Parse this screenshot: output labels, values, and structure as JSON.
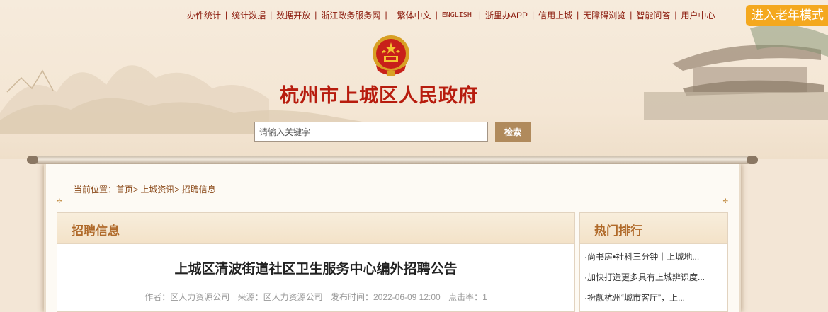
{
  "topnav": {
    "items": [
      "办件统计",
      "统计数据",
      "数据开放",
      "浙江政务服务网",
      "繁体中文",
      "ENGLISH",
      "浙里办APP",
      "信用上城",
      "无障碍浏览",
      "智能问答",
      "用户中心"
    ]
  },
  "elder_mode_label": "进入老年模式",
  "site_title": "杭州市上城区人民政府",
  "search": {
    "placeholder": "请输入关键字",
    "button": "检索"
  },
  "breadcrumb": {
    "prefix": "当前位置：",
    "items": [
      "首页",
      "上城资讯",
      "招聘信息"
    ],
    "separator": ">"
  },
  "main": {
    "section_title": "招聘信息",
    "article_title": "上城区清波街道社区卫生服务中心编外招聘公告",
    "meta": {
      "author": "作者：区人力资源公司",
      "source": "来源：区人力资源公司",
      "published": "发布时间：2022-06-09 12:00",
      "clicks": "点击率：1"
    }
  },
  "sidebar": {
    "title": "热门排行",
    "items": [
      "·尚书房•社科三分钟｜上城地...",
      "·加快打造更多具有上城辨识度...",
      "·扮靓杭州“城市客厅”，上..."
    ]
  },
  "colors": {
    "accent_red": "#b71c0e",
    "elder_orange": "#f4a81e",
    "panel_title": "#b06a2a",
    "button_brown": "#b08a5c"
  }
}
